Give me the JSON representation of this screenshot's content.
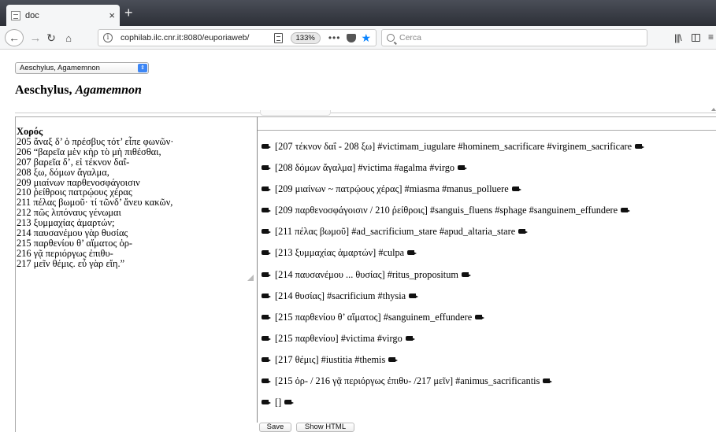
{
  "browser": {
    "tab_title": "doc",
    "tab_close": "×",
    "new_tab": "+",
    "url": "cophilab.ilc.cnr.it:8080/euporiaweb/",
    "zoom": "133%",
    "more_actions": "•••",
    "search_placeholder": "Cerca",
    "icons": [
      "back-icon",
      "forward-icon",
      "reload-icon",
      "home-icon",
      "info-icon",
      "reader-view-icon",
      "pocket-icon",
      "bookmark-star-icon",
      "search-icon",
      "library-icon",
      "sidebar-icon",
      "menu-icon"
    ],
    "accent_color": "#0a84ff"
  },
  "page": {
    "work_select": {
      "value": "Aeschylus, Agamemnon"
    },
    "heading": {
      "author": "Aeschylus,",
      "title": "Agamemnon"
    },
    "text": {
      "speaker": "Χορός",
      "lines": [
        "205 ἄναξ δ’ ὁ πρέσβυς τότ’ εἶπε φωνῶν·",
        "206 “βαρεῖα μὲν κὴρ τὸ μὴ πιθέσθαι,",
        "207 βαρεῖα δ’, εἰ τέκνον δαΐ-",
        "208 ξω, δόμων ἄγαλμα,",
        "209 μιαίνων παρθενοσφάγοισιν",
        "210 ῥείθροις πατρῴους χέρας",
        "211 πέλας βωμοῦ· τί τῶνδ’ ἄνευ κακῶν,",
        "212 πῶς λιπόναυς γένωμαι",
        "213 ξυμμαχίας ἁμαρτών;",
        "214 παυσανέμου γὰρ θυσίας",
        "215 παρθενίου θ’ αἵματος ὀρ-",
        "216 γᾷ περιόργως ἐπιθυ-",
        "217 μεῖν θέμις. εὖ γὰρ εἴη.”"
      ]
    },
    "annotations": [
      "[207 τέκνον δαΐ - 208 ξω] #victimam_iugulare #hominem_sacrificare #virginem_sacrificare",
      "[208 δόμων ἄγαλμα] #victima #agalma #virgo",
      "[209 μιαίνων ~ πατρῴους χέρας] #miasma #manus_polluere",
      "[209 παρθενοσφάγοισιν / 210 ῥείθροις] #sanguis_fluens #sphage #sanguinem_effundere",
      "[211 πέλας βωμοῦ] #ad_sacrificium_stare #apud_altaria_stare",
      "[213 ξυμμαχίας ἁμαρτών] #culpa",
      "[214 παυσανέμου ... θυσίας] #ritus_propositum",
      "[214 θυσίας] #sacrificium #thysia",
      "[215 παρθενίου θ’ αἵματος] #sanguinem_effundere",
      "[215 παρθενίου] #victima #virgo",
      "[217 θέμις] #iustitia #themis",
      "[215 ὀρ- / 216 γᾷ περιόργως ἐπιθυ- /217 μεῖν] #animus_sacrificantis",
      "[]"
    ],
    "buttons": {
      "save": "Save",
      "show_html": "Show HTML"
    }
  }
}
